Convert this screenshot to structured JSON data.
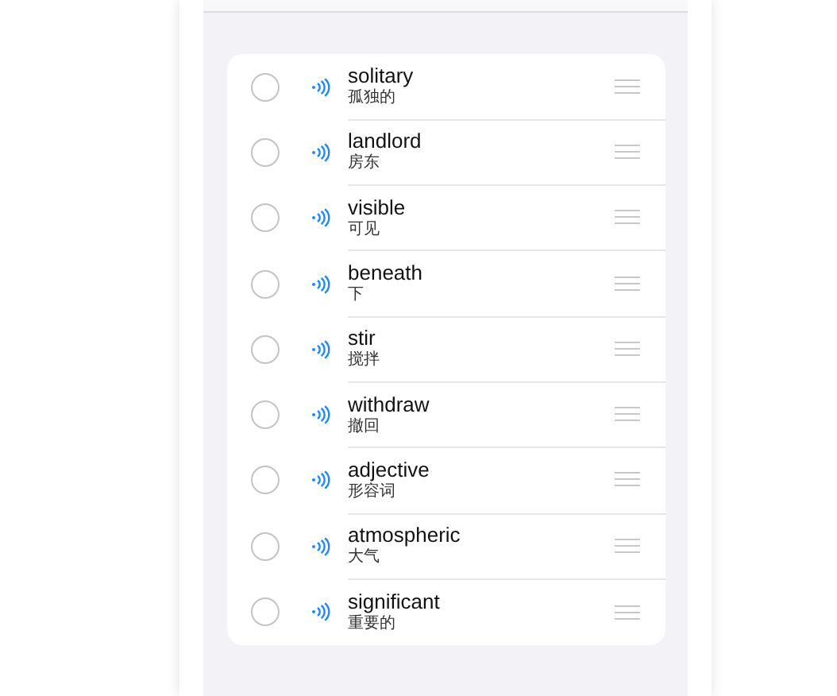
{
  "words": [
    {
      "word": "solitary",
      "meaning": "孤独的",
      "checked": false
    },
    {
      "word": "landlord",
      "meaning": "房东",
      "checked": false
    },
    {
      "word": "visible",
      "meaning": "可见",
      "checked": false
    },
    {
      "word": "beneath",
      "meaning": "下",
      "checked": false
    },
    {
      "word": "stir",
      "meaning": "搅拌",
      "checked": false
    },
    {
      "word": "withdraw",
      "meaning": "撤回",
      "checked": false
    },
    {
      "word": "adjective",
      "meaning": "形容词",
      "checked": false
    },
    {
      "word": "atmospheric",
      "meaning": "大气",
      "checked": false
    },
    {
      "word": "significant",
      "meaning": "重要的",
      "checked": false
    }
  ]
}
